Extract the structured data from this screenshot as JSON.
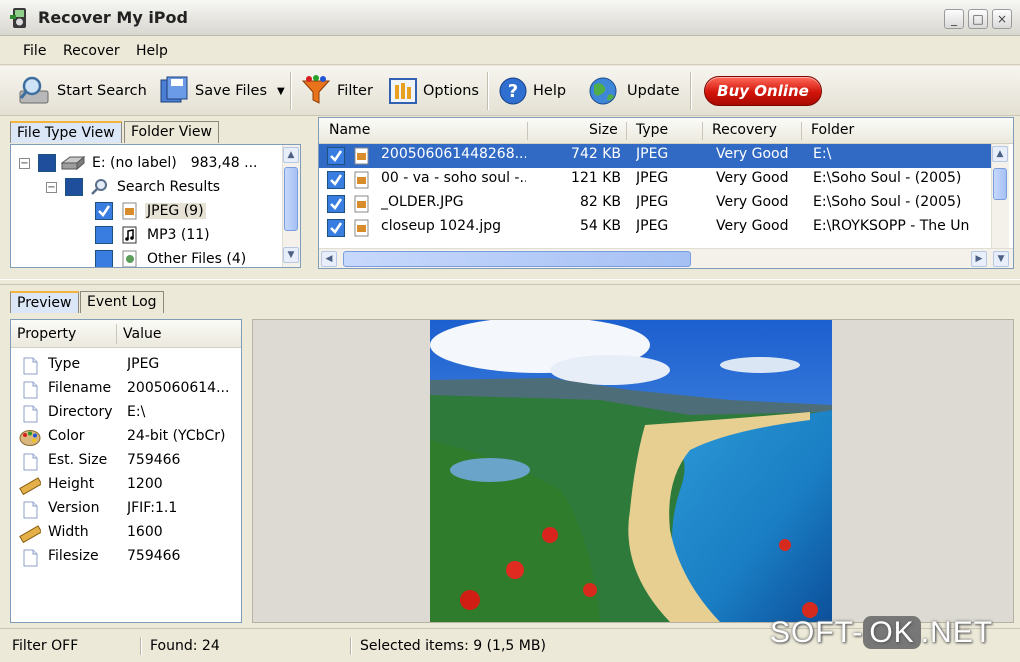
{
  "window": {
    "title": "Recover My iPod"
  },
  "menu": [
    "File",
    "Recover",
    "Help"
  ],
  "toolbar": {
    "start_search": "Start Search",
    "save_files": "Save Files",
    "filter": "Filter",
    "options": "Options",
    "help": "Help",
    "update": "Update",
    "buy_online": "Buy Online"
  },
  "left_tabs": {
    "file_type_view": "File Type View",
    "folder_view": "Folder View"
  },
  "tree": {
    "drive": "E: (no label)",
    "drive_size": "983,48 ...",
    "search_results": "Search Results",
    "jpeg": "JPEG (9)",
    "mp3": "MP3 (11)",
    "other": "Other Files (4)"
  },
  "filelist": {
    "columns": {
      "name": "Name",
      "size": "Size",
      "type": "Type",
      "recovery": "Recovery",
      "folder": "Folder"
    },
    "rows": [
      {
        "name": "200506061448268...",
        "size": "742 KB",
        "type": "JPEG",
        "recovery": "Very Good",
        "folder": "E:\\"
      },
      {
        "name": "00 - va - soho soul -...",
        "size": "121 KB",
        "type": "JPEG",
        "recovery": "Very Good",
        "folder": "E:\\Soho Soul  - (2005)"
      },
      {
        "name": "_OLDER.JPG",
        "size": "82 KB",
        "type": "JPEG",
        "recovery": "Very Good",
        "folder": "E:\\Soho Soul  - (2005)"
      },
      {
        "name": "closeup 1024.jpg",
        "size": "54 KB",
        "type": "JPEG",
        "recovery": "Very Good",
        "folder": "E:\\ROYKSOPP  - The Un"
      }
    ]
  },
  "bottom_tabs": {
    "preview": "Preview",
    "event_log": "Event Log"
  },
  "properties": {
    "header_property": "Property",
    "header_value": "Value",
    "rows": [
      {
        "name": "Type",
        "value": "JPEG",
        "icon": "document-icon"
      },
      {
        "name": "Filename",
        "value": "2005060614...",
        "icon": "document-icon"
      },
      {
        "name": "Directory",
        "value": "E:\\",
        "icon": "document-icon"
      },
      {
        "name": "Color",
        "value": "24-bit (YCbCr)",
        "icon": "palette-icon"
      },
      {
        "name": "Est. Size",
        "value": "759466",
        "icon": "document-icon"
      },
      {
        "name": "Height",
        "value": "1200",
        "icon": "ruler-icon"
      },
      {
        "name": "Version",
        "value": "JFIF:1.1",
        "icon": "document-icon"
      },
      {
        "name": "Width",
        "value": "1600",
        "icon": "ruler-icon"
      },
      {
        "name": "Filesize",
        "value": "759466",
        "icon": "document-icon"
      }
    ]
  },
  "status": {
    "filter": "Filter OFF",
    "found": "Found: 24",
    "selected": "Selected items: 9 (1,5 MB)"
  },
  "watermark": {
    "left": "SOFT-",
    "ok": "OK",
    "right": ".NET"
  },
  "colors": {
    "selection": "#316ac5",
    "buy_button": "#d1140a",
    "window_bg": "#ece9d8"
  }
}
